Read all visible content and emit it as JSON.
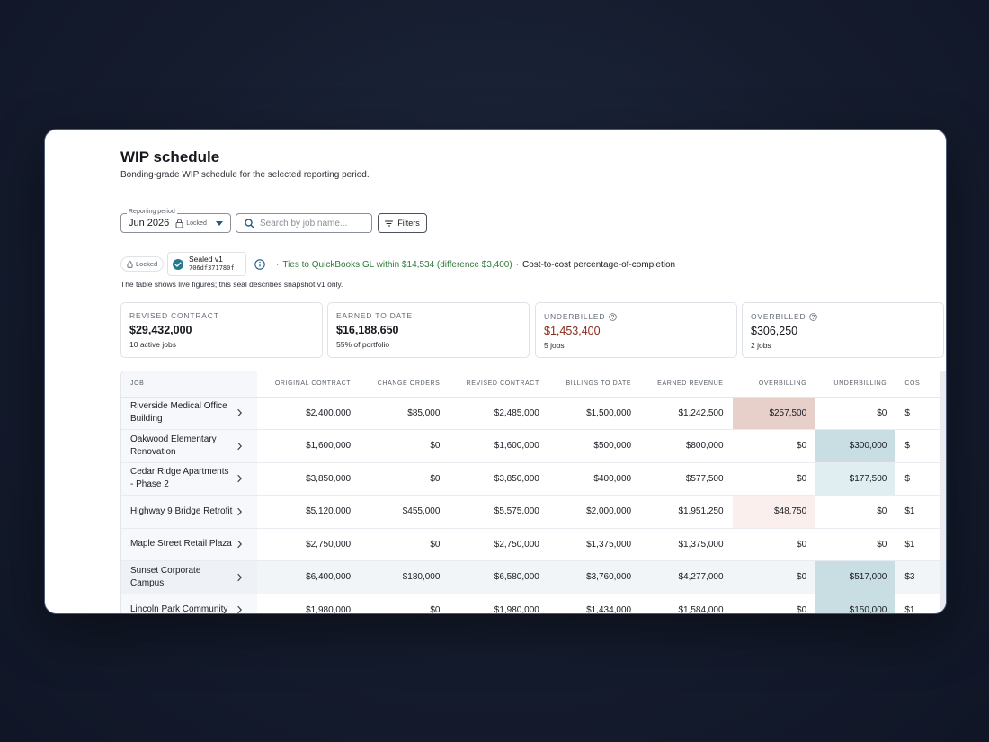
{
  "page": {
    "title": "WIP schedule",
    "subtitle": "Bonding-grade WIP schedule for the selected reporting period."
  },
  "controls": {
    "period_legend": "Reporting period",
    "period_value": "Jun 2026",
    "period_locked": "Locked",
    "search_placeholder": "Search by job name...",
    "filters_label": "Filters"
  },
  "seal": {
    "locked_label": "Locked",
    "title": "Sealed v1",
    "hash": "706df371780f",
    "ties_text": "Ties to QuickBooks GL within $14,534 (difference $3,400)",
    "method_text": "Cost-to-cost percentage-of-completion",
    "note": "The table shows live figures; this seal describes snapshot v1 only."
  },
  "kpis": [
    {
      "label": "REVISED CONTRACT",
      "value": "$29,432,000",
      "sub": "10 active jobs"
    },
    {
      "label": "EARNED TO DATE",
      "value": "$16,188,650",
      "sub": "55% of portfolio"
    },
    {
      "label": "UNDERBILLED",
      "value": "$1,453,400",
      "sub": "5 jobs"
    },
    {
      "label": "OVERBILLED",
      "value": "$306,250",
      "sub": "2 jobs"
    }
  ],
  "table": {
    "columns": [
      "JOB",
      "ORIGINAL CONTRACT",
      "CHANGE ORDERS",
      "REVISED CONTRACT",
      "BILLINGS TO DATE",
      "EARNED REVENUE",
      "OVERBILLING",
      "UNDERBILLING",
      "COS"
    ],
    "rows": [
      {
        "job": "Riverside Medical Office Building",
        "original": "$2,400,000",
        "changes": "$85,000",
        "revised": "$2,485,000",
        "billings": "$1,500,000",
        "earned": "$1,242,500",
        "over": "$257,500",
        "under": "$0",
        "cost": "$"
      },
      {
        "job": "Oakwood Elementary Renovation",
        "original": "$1,600,000",
        "changes": "$0",
        "revised": "$1,600,000",
        "billings": "$500,000",
        "earned": "$800,000",
        "over": "$0",
        "under": "$300,000",
        "cost": "$"
      },
      {
        "job": "Cedar Ridge Apartments - Phase 2",
        "original": "$3,850,000",
        "changes": "$0",
        "revised": "$3,850,000",
        "billings": "$400,000",
        "earned": "$577,500",
        "over": "$0",
        "under": "$177,500",
        "cost": "$"
      },
      {
        "job": "Highway 9 Bridge Retrofit",
        "original": "$5,120,000",
        "changes": "$455,000",
        "revised": "$5,575,000",
        "billings": "$2,000,000",
        "earned": "$1,951,250",
        "over": "$48,750",
        "under": "$0",
        "cost": "$1"
      },
      {
        "job": "Maple Street Retail Plaza",
        "original": "$2,750,000",
        "changes": "$0",
        "revised": "$2,750,000",
        "billings": "$1,375,000",
        "earned": "$1,375,000",
        "over": "$0",
        "under": "$0",
        "cost": "$1"
      },
      {
        "job": "Sunset Corporate Campus",
        "original": "$6,400,000",
        "changes": "$180,000",
        "revised": "$6,580,000",
        "billings": "$3,760,000",
        "earned": "$4,277,000",
        "over": "$0",
        "under": "$517,000",
        "cost": "$3"
      },
      {
        "job": "Lincoln Park Community",
        "original": "$1,980,000",
        "changes": "$0",
        "revised": "$1,980,000",
        "billings": "$1,434,000",
        "earned": "$1,584,000",
        "over": "$0",
        "under": "$150,000",
        "cost": "$1"
      }
    ]
  },
  "colors": {
    "accent": "#1f5c8a",
    "ties_green": "#2f7a3a",
    "underbilled_red": "#8a2a1c",
    "overbilling_strong": "#e6d0c9",
    "underbilling_strong": "#c9dee3"
  }
}
